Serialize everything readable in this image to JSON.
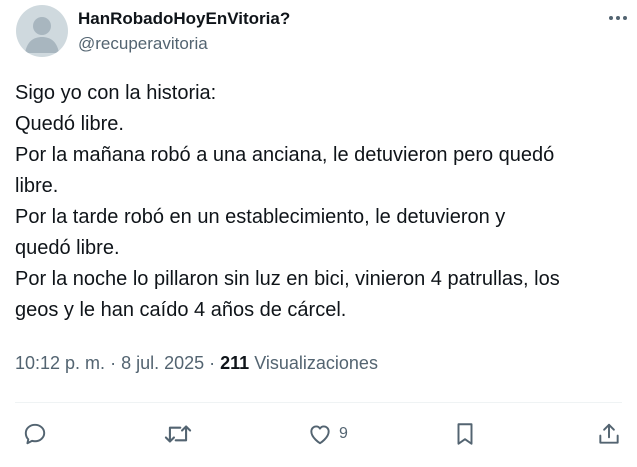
{
  "author": {
    "name": "HanRobadoHoyEnVitoria?",
    "handle": "@recuperavitoria"
  },
  "tweet": {
    "lines": [
      "Sigo yo con la historia:",
      "Quedó libre.",
      "Por la mañana robó a una anciana, le detuvieron pero quedó",
      "libre.",
      "Por la tarde robó en un establecimiento, le detuvieron y",
      "quedó libre.",
      "Por la noche lo pillaron sin luz en bici, vinieron 4 patrullas, los",
      "geos y le han caído 4 años de cárcel."
    ]
  },
  "meta": {
    "time": "10:12 p. m.",
    "separator": " · ",
    "date": "8 jul. 2025",
    "views_count": "211",
    "views_label": "Visualizaciones"
  },
  "actions": {
    "reply": {
      "icon": "reply-icon"
    },
    "repost": {
      "icon": "repost-icon"
    },
    "like": {
      "icon": "heart-icon",
      "count": "9"
    },
    "bookmark": {
      "icon": "bookmark-icon"
    },
    "share": {
      "icon": "share-icon"
    }
  },
  "colors": {
    "text_primary": "#0f1419",
    "text_secondary": "#536471",
    "divider": "#eff3f4",
    "avatar_bg": "#cfd9de"
  }
}
